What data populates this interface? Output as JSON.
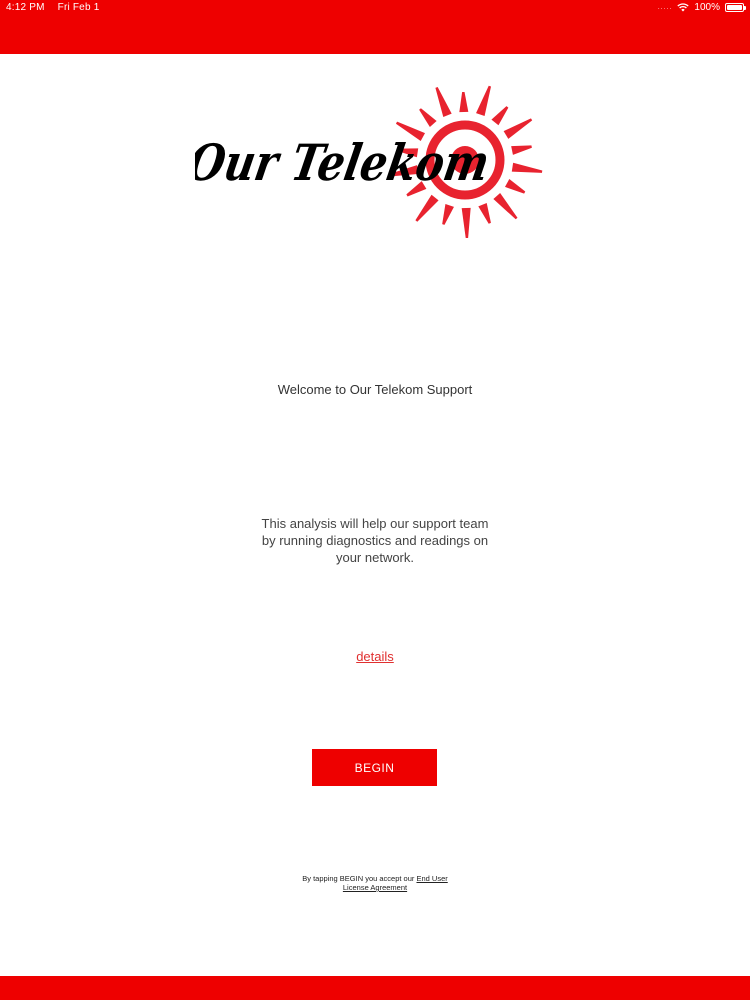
{
  "status_bar": {
    "time": "4:12 PM",
    "date": "Fri Feb 1",
    "signal": ".....",
    "battery_text": "100%",
    "battery_level": 1.0,
    "wifi_icon": "wifi-icon",
    "battery_icon": "battery-icon"
  },
  "logo": {
    "text": "Our Telekom",
    "sun_color": "#e8232f",
    "text_color": "#000000"
  },
  "welcome_text": "Welcome to Our Telekom Support",
  "description": "This analysis will help our support team by running diagnostics and readings on your network.",
  "details_link": "details",
  "begin_button": "BEGIN",
  "eula": {
    "prefix": "By tapping BEGIN you accept our ",
    "link_text": "End User License Agreement"
  },
  "colors": {
    "brand_red": "#ee0000",
    "link_red": "#e03030"
  }
}
